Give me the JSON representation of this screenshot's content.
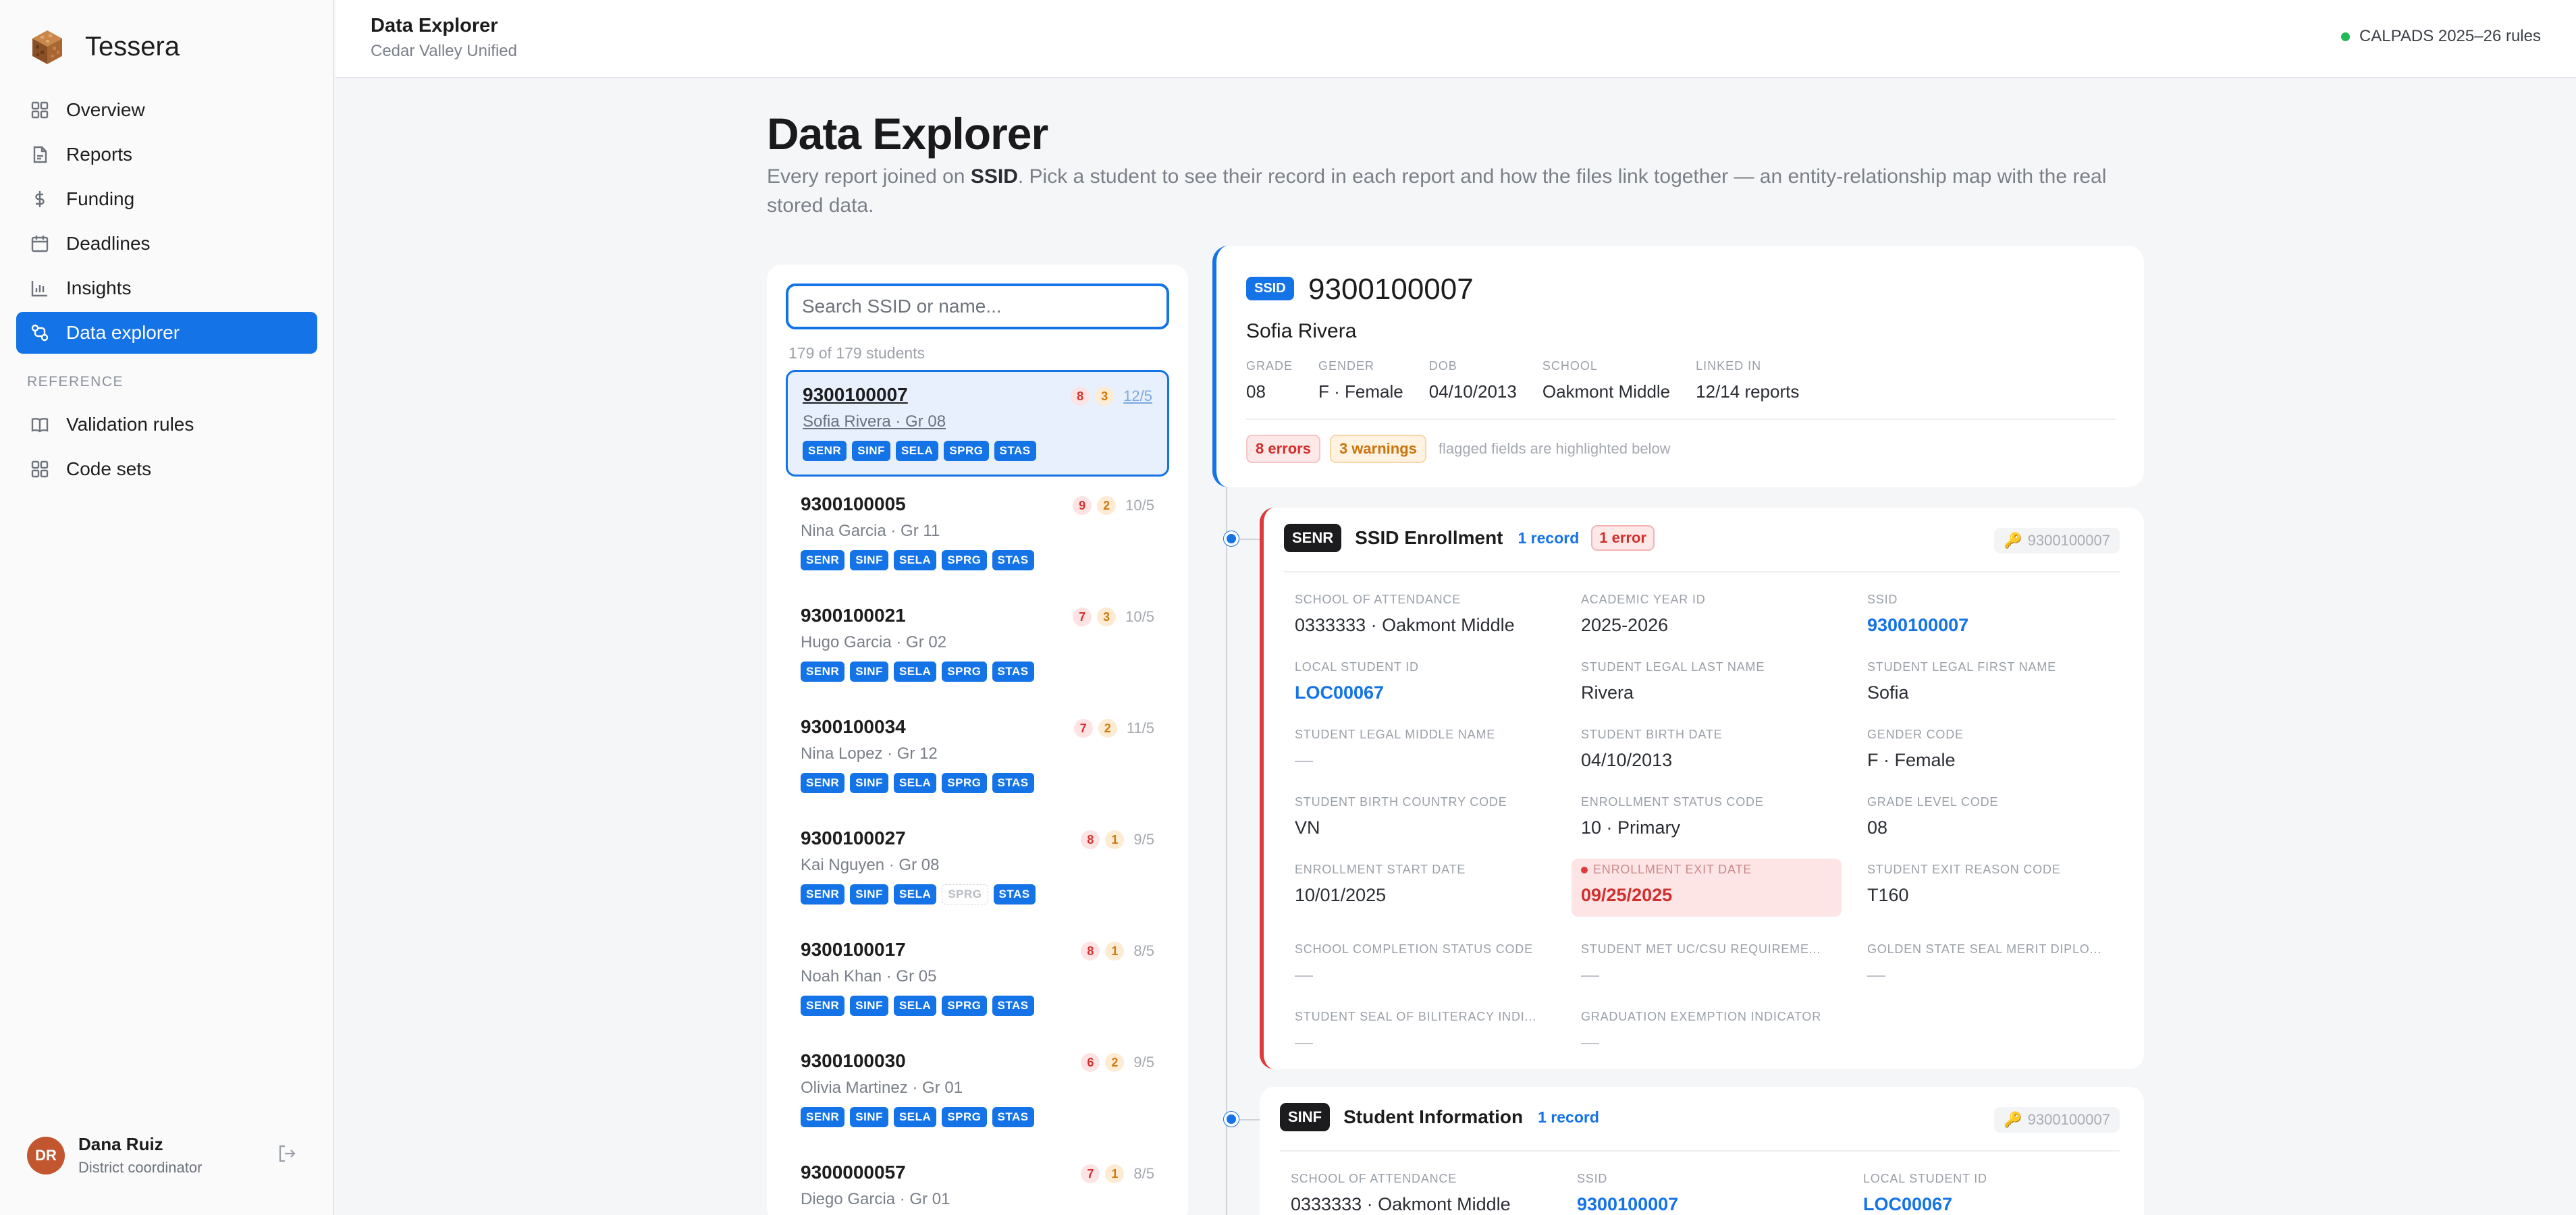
{
  "app": {
    "name": "Tessera",
    "logo": "cube-logo"
  },
  "nav": {
    "items": [
      {
        "label": "Overview",
        "icon": "grid-icon"
      },
      {
        "label": "Reports",
        "icon": "document-icon"
      },
      {
        "label": "Funding",
        "icon": "dollar-icon"
      },
      {
        "label": "Deadlines",
        "icon": "calendar-icon"
      },
      {
        "label": "Insights",
        "icon": "bar-chart-icon"
      },
      {
        "label": "Data explorer",
        "icon": "relationship-icon",
        "active": true
      }
    ],
    "section": "REFERENCE",
    "reference": [
      {
        "label": "Validation rules",
        "icon": "book-icon"
      },
      {
        "label": "Code sets",
        "icon": "grid-icon"
      }
    ]
  },
  "user": {
    "initials": "DR",
    "name": "Dana Ruiz",
    "role": "District coordinator"
  },
  "topbar": {
    "title": "Data Explorer",
    "subtitle": "Cedar Valley Unified",
    "rules": "CALPADS 2025–26 rules",
    "status_color": "#1fba55"
  },
  "page": {
    "title": "Data Explorer",
    "lead_1": "Every report joined on ",
    "lead_key": "SSID",
    "lead_2": ". Pick a student to see their record in each report and how the files link together — an entity-relationship map with the real stored data."
  },
  "search": {
    "placeholder": "Search SSID or name...",
    "count": "179 of 179 students"
  },
  "students": [
    {
      "ssid": "9300100007",
      "name": "Sofia Rivera · Gr 08",
      "errors": "8",
      "warnings": "3",
      "links": "12/5",
      "tags": [
        "SENR",
        "SINF",
        "SELA",
        "SPRG",
        "STAS"
      ],
      "off": [],
      "selected": true
    },
    {
      "ssid": "9300100005",
      "name": "Nina Garcia · Gr 11",
      "errors": "9",
      "warnings": "2",
      "links": "10/5",
      "tags": [
        "SENR",
        "SINF",
        "SELA",
        "SPRG",
        "STAS"
      ],
      "off": []
    },
    {
      "ssid": "9300100021",
      "name": "Hugo Garcia · Gr 02",
      "errors": "7",
      "warnings": "3",
      "links": "10/5",
      "tags": [
        "SENR",
        "SINF",
        "SELA",
        "SPRG",
        "STAS"
      ],
      "off": []
    },
    {
      "ssid": "9300100034",
      "name": "Nina Lopez · Gr 12",
      "errors": "7",
      "warnings": "2",
      "links": "11/5",
      "tags": [
        "SENR",
        "SINF",
        "SELA",
        "SPRG",
        "STAS"
      ],
      "off": []
    },
    {
      "ssid": "9300100027",
      "name": "Kai Nguyen · Gr 08",
      "errors": "8",
      "warnings": "1",
      "links": "9/5",
      "tags": [
        "SENR",
        "SINF",
        "SELA",
        "SPRG",
        "STAS"
      ],
      "off": [
        "SPRG"
      ]
    },
    {
      "ssid": "9300100017",
      "name": "Noah Khan · Gr 05",
      "errors": "8",
      "warnings": "1",
      "links": "8/5",
      "tags": [
        "SENR",
        "SINF",
        "SELA",
        "SPRG",
        "STAS"
      ],
      "off": []
    },
    {
      "ssid": "9300100030",
      "name": "Olivia Martinez · Gr 01",
      "errors": "6",
      "warnings": "2",
      "links": "9/5",
      "tags": [
        "SENR",
        "SINF",
        "SELA",
        "SPRG",
        "STAS"
      ],
      "off": []
    },
    {
      "ssid": "9300000057",
      "name": "Diego Garcia · Gr 01",
      "errors": "7",
      "warnings": "1",
      "links": "8/5",
      "tags": [
        "SENR",
        "SINF",
        "SELA",
        "SPRG",
        "STAS"
      ],
      "off": []
    }
  ],
  "profile": {
    "pill": "SSID",
    "ssid": "9300100007",
    "name": "Sofia Rivera",
    "facts": [
      {
        "label": "GRADE",
        "value": "08"
      },
      {
        "label": "GENDER",
        "value": "F · Female"
      },
      {
        "label": "DOB",
        "value": "04/10/2013"
      },
      {
        "label": "SCHOOL",
        "value": "Oakmont Middle"
      },
      {
        "label": "LINKED IN",
        "value": "12/14 reports"
      }
    ],
    "errors": "8 errors",
    "warnings": "3 warnings",
    "note": "flagged fields are highlighted below"
  },
  "records": [
    {
      "code": "SENR",
      "title": "SSID Enrollment",
      "count": "1 record",
      "error": "1 error",
      "key": "9300100007",
      "fields": [
        {
          "label": "SCHOOL OF ATTENDANCE",
          "value": "0333333 · Oakmont Middle"
        },
        {
          "label": "ACADEMIC YEAR ID",
          "value": "2025-2026"
        },
        {
          "label": "SSID",
          "value": "9300100007",
          "link": true
        },
        {
          "label": "LOCAL STUDENT ID",
          "value": "LOC00067",
          "link": true
        },
        {
          "label": "STUDENT LEGAL LAST NAME",
          "value": "Rivera"
        },
        {
          "label": "STUDENT LEGAL FIRST NAME",
          "value": "Sofia"
        },
        {
          "label": "STUDENT LEGAL MIDDLE NAME",
          "value": "—",
          "empty": true
        },
        {
          "label": "STUDENT BIRTH DATE",
          "value": "04/10/2013"
        },
        {
          "label": "GENDER CODE",
          "value": "F · Female"
        },
        {
          "label": "STUDENT BIRTH COUNTRY CODE",
          "value": "VN"
        },
        {
          "label": "ENROLLMENT STATUS CODE",
          "value": "10 · Primary"
        },
        {
          "label": "GRADE LEVEL CODE",
          "value": "08"
        },
        {
          "label": "ENROLLMENT START DATE",
          "value": "10/01/2025"
        },
        {
          "label": "ENROLLMENT EXIT DATE",
          "value": "09/25/2025",
          "flag": true
        },
        {
          "label": "STUDENT EXIT REASON CODE",
          "value": "T160"
        },
        {
          "label": "SCHOOL COMPLETION STATUS CODE",
          "value": "—",
          "empty": true
        },
        {
          "label": "STUDENT MET UC/CSU REQUIREME...",
          "value": "—",
          "empty": true
        },
        {
          "label": "GOLDEN STATE SEAL MERIT DIPLO...",
          "value": "—",
          "empty": true
        },
        {
          "label": "STUDENT SEAL OF BILITERACY INDI...",
          "value": "—",
          "empty": true
        },
        {
          "label": "GRADUATION EXEMPTION INDICATOR",
          "value": "—",
          "empty": true
        }
      ]
    },
    {
      "code": "SINF",
      "title": "Student Information",
      "count": "1 record",
      "key": "9300100007",
      "fields": [
        {
          "label": "SCHOOL OF ATTENDANCE",
          "value": "0333333 · Oakmont Middle"
        },
        {
          "label": "SSID",
          "value": "9300100007",
          "link": true
        },
        {
          "label": "LOCAL STUDENT ID",
          "value": "LOC00067",
          "link": true
        }
      ]
    }
  ]
}
